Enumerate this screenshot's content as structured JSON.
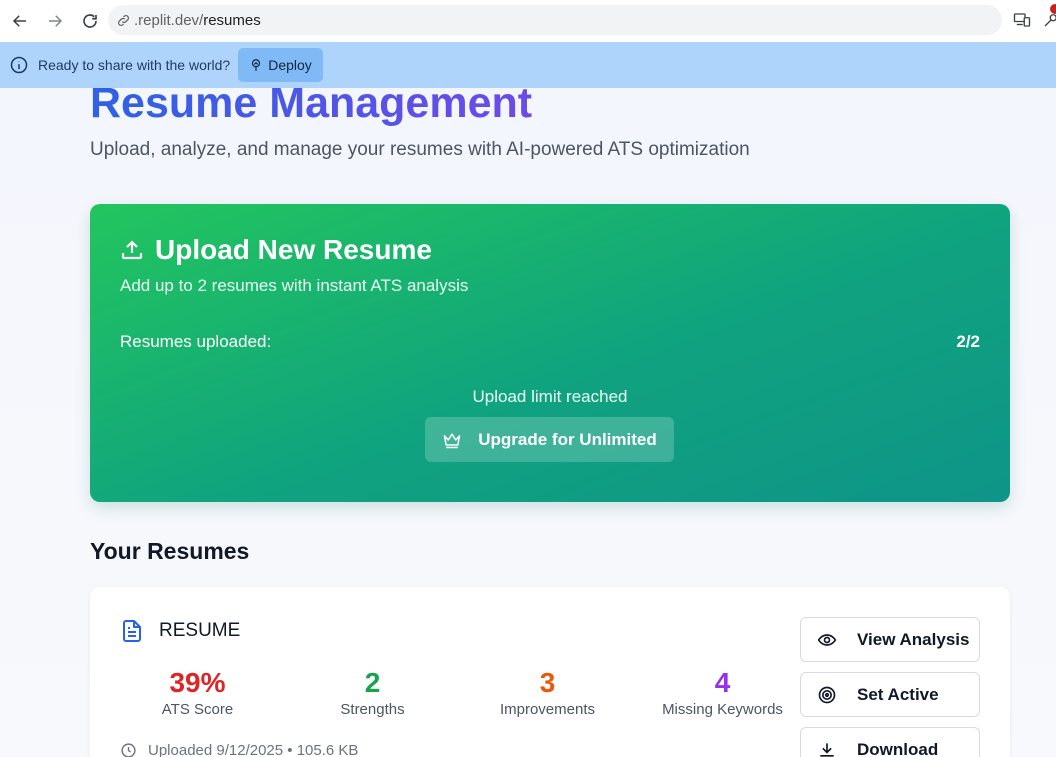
{
  "browser": {
    "url_prefix": ".replit.dev/",
    "url_path": "resumes"
  },
  "banner": {
    "message": "Ready to share with the world?",
    "deploy_label": "Deploy"
  },
  "page": {
    "title": "Resume Management",
    "subtitle": "Upload, analyze, and manage your resumes with AI-powered ATS optimization"
  },
  "upload": {
    "title": "Upload New Resume",
    "subtitle": "Add up to 2 resumes with instant ATS analysis",
    "count_label": "Resumes uploaded:",
    "count_value": "2/2",
    "limit_text": "Upload limit reached",
    "upgrade_label": "Upgrade for Unlimited"
  },
  "resumes": {
    "section_title": "Your Resumes",
    "items": [
      {
        "name": "RESUME",
        "stats": [
          {
            "value": "39%",
            "label": "ATS Score",
            "color": "#dc2626"
          },
          {
            "value": "2",
            "label": "Strengths",
            "color": "#16a34a"
          },
          {
            "value": "3",
            "label": "Improvements",
            "color": "#ea580c"
          },
          {
            "value": "4",
            "label": "Missing Keywords",
            "color": "#9333ea"
          }
        ],
        "uploaded_text": "Uploaded 9/12/2025 • 105.6 KB",
        "actions": {
          "view": "View Analysis",
          "set_active": "Set Active",
          "download": "Download"
        }
      }
    ]
  }
}
